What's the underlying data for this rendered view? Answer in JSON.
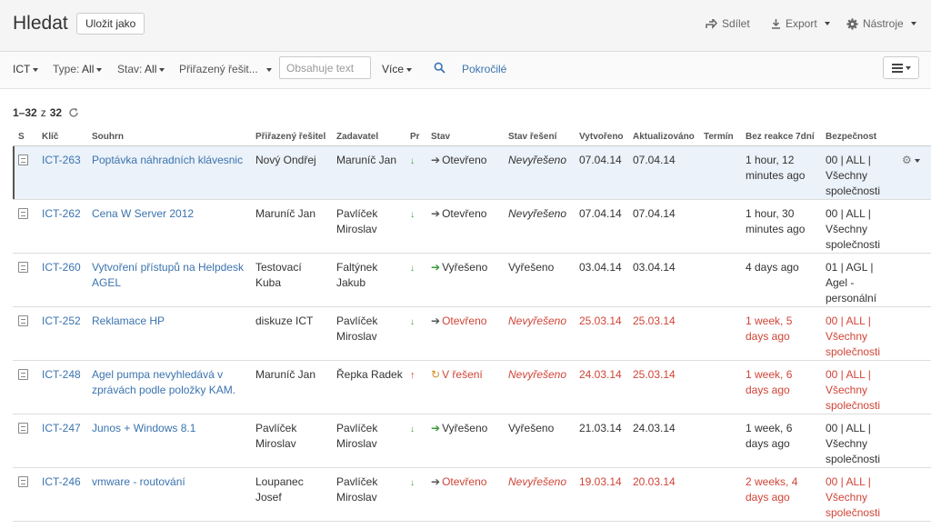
{
  "header": {
    "title": "Hledat",
    "save_as": "Uložit jako",
    "share": "Sdílet",
    "export": "Export",
    "tools": "Nástroje"
  },
  "filters": {
    "project": "ICT",
    "type_label": "Type:",
    "type_value": "All",
    "status_label": "Stav:",
    "status_value": "All",
    "assignee": "Přiřazený řešit...",
    "text_placeholder": "Obsahuje text",
    "more": "Více",
    "advanced": "Pokročilé"
  },
  "results": {
    "range": "1–32",
    "of": "z",
    "total": "32"
  },
  "table": {
    "columns": [
      "S",
      "Klíč",
      "Souhrn",
      "Přiřazený řešitel",
      "Zadavatel",
      "Pr",
      "Stav",
      "Stav řešení",
      "Vytvořeno",
      "Aktualizováno",
      "Termín",
      "Bez reakce 7dní",
      "Bezpečnost"
    ],
    "rows": [
      {
        "key": "ICT-263",
        "summary": "Poptávka náhradních klávesnic",
        "assignee": "Nový Ondřej",
        "reporter": "Maruníč Jan",
        "priority": "down",
        "status": "Otevřeno",
        "resolution": "Nevyřešeno",
        "created": "07.04.14",
        "updated": "07.04.14",
        "due": "",
        "no_reaction": "1 hour, 12 minutes ago",
        "security": "00 | ALL | Všechny společnosti"
      },
      {
        "key": "ICT-262",
        "summary": "Cena W Server 2012",
        "assignee": "Maruníč Jan",
        "reporter": "Pavlíček Miroslav",
        "priority": "down",
        "status": "Otevřeno",
        "resolution": "Nevyřešeno",
        "created": "07.04.14",
        "updated": "07.04.14",
        "due": "",
        "no_reaction": "1 hour, 30 minutes ago",
        "security": "00 | ALL | Všechny společnosti"
      },
      {
        "key": "ICT-260",
        "summary": "Vytvoření přístupů na Helpdesk AGEL",
        "assignee": "Testovací Kuba",
        "reporter": "Faltýnek Jakub",
        "priority": "down",
        "status": "Vyřešeno",
        "resolution": "Vyřešeno",
        "created": "03.04.14",
        "updated": "03.04.14",
        "due": "",
        "no_reaction": "4 days ago",
        "security": "01 | AGL | Agel - personální"
      },
      {
        "key": "ICT-252",
        "summary": "Reklamace HP",
        "assignee": "diskuze ICT",
        "reporter": "Pavlíček Miroslav",
        "priority": "down",
        "status": "Otevřeno",
        "resolution": "Nevyřešeno",
        "created": "25.03.14",
        "updated": "25.03.14",
        "due": "",
        "no_reaction": "1 week, 5 days ago",
        "security": "00 | ALL | Všechny společnosti"
      },
      {
        "key": "ICT-248",
        "summary": "Agel pumpa nevyhledává v zprávách podle položky KAM.",
        "assignee": "Maruníč Jan",
        "reporter": "Řepka Radek",
        "priority": "up",
        "status": "V řešení",
        "resolution": "Nevyřešeno",
        "created": "24.03.14",
        "updated": "25.03.14",
        "due": "",
        "no_reaction": "1 week, 6 days ago",
        "security": "00 | ALL | Všechny společnosti"
      },
      {
        "key": "ICT-247",
        "summary": "Junos + Windows 8.1",
        "assignee": "Pavlíček Miroslav",
        "reporter": "Pavlíček Miroslav",
        "priority": "down",
        "status": "Vyřešeno",
        "resolution": "Vyřešeno",
        "created": "21.03.14",
        "updated": "24.03.14",
        "due": "",
        "no_reaction": "1 week, 6 days ago",
        "security": "00 | ALL | Všechny společnosti"
      },
      {
        "key": "ICT-246",
        "summary": "vmware - routování",
        "assignee": "Loupanec Josef",
        "reporter": "Pavlíček Miroslav",
        "priority": "down",
        "status": "Otevřeno",
        "resolution": "Nevyřešeno",
        "created": "19.03.14",
        "updated": "20.03.14",
        "due": "",
        "no_reaction": "2 weeks, 4 days ago",
        "security": "00 | ALL | Všechny společnosti"
      }
    ]
  },
  "colors": {
    "link": "#3b73af",
    "overdue": "#d04437",
    "selected_row": "#ebf2f9"
  }
}
